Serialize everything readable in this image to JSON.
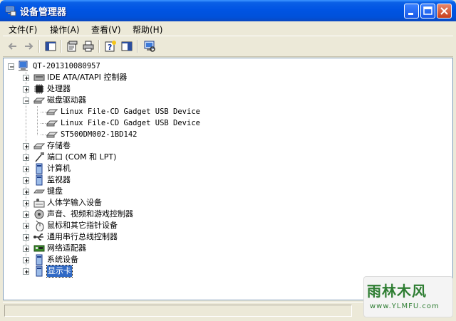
{
  "window": {
    "title": "设备管理器"
  },
  "menu": [
    "文件(F)",
    "操作(A)",
    "查看(V)",
    "帮助(H)"
  ],
  "toolbar_icons": [
    "back-arrow-icon",
    "forward-arrow-icon",
    "console-tree-icon",
    "properties-icon",
    "print-icon",
    "help-icon",
    "show-hide-icon",
    "scan-hardware-icon"
  ],
  "tree": {
    "root": "QT-201310080957",
    "categories": [
      {
        "label": "IDE ATA/ATAPI 控制器",
        "icon": "ide-controller-icon",
        "expanded": false
      },
      {
        "label": "处理器",
        "icon": "processor-icon",
        "expanded": false
      },
      {
        "label": "磁盘驱动器",
        "icon": "disk-drive-icon",
        "expanded": true,
        "children": [
          "Linux File-CD Gadget USB Device",
          "Linux File-CD Gadget USB Device",
          "ST500DM002-1BD142"
        ]
      },
      {
        "label": "存储卷",
        "icon": "storage-volume-icon",
        "expanded": false
      },
      {
        "label": "端口 (COM 和 LPT)",
        "icon": "port-icon",
        "expanded": false
      },
      {
        "label": "计算机",
        "icon": "computer-icon",
        "expanded": false
      },
      {
        "label": "监视器",
        "icon": "monitor-icon",
        "expanded": false
      },
      {
        "label": "键盘",
        "icon": "keyboard-icon",
        "expanded": false
      },
      {
        "label": "人体学输入设备",
        "icon": "hid-icon",
        "expanded": false
      },
      {
        "label": "声音、视频和游戏控制器",
        "icon": "sound-icon",
        "expanded": false
      },
      {
        "label": "鼠标和其它指针设备",
        "icon": "mouse-icon",
        "expanded": false
      },
      {
        "label": "通用串行总线控制器",
        "icon": "usb-icon",
        "expanded": false
      },
      {
        "label": "网络适配器",
        "icon": "network-adapter-icon",
        "expanded": false
      },
      {
        "label": "系统设备",
        "icon": "system-device-icon",
        "expanded": false
      },
      {
        "label": "显示卡",
        "icon": "display-adapter-icon",
        "expanded": false,
        "selected": true
      }
    ]
  },
  "watermark": {
    "title": "雨林木风",
    "url": "www.YLMFU.com"
  }
}
